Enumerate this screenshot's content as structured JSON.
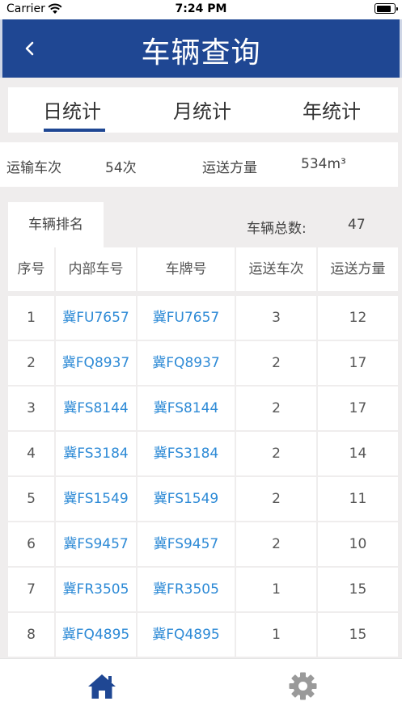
{
  "status_bar": {
    "carrier": "Carrier",
    "time": "7:24 PM"
  },
  "nav": {
    "title": "车辆查询"
  },
  "tabs": [
    {
      "label": "日统计",
      "selected": true
    },
    {
      "label": "月统计",
      "selected": false
    },
    {
      "label": "年统计",
      "selected": false
    }
  ],
  "summary": {
    "trips_label": "运输车次",
    "trips_value": "54次",
    "volume_label": "运送方量",
    "volume_value": "534m³"
  },
  "ranking": {
    "tab_label": "车辆排名",
    "total_label": "车辆总数:",
    "total_value": "47"
  },
  "table": {
    "headers": [
      "序号",
      "内部车号",
      "车牌号",
      "运送车次",
      "运送方量"
    ],
    "rows": [
      [
        "1",
        "冀FU7657",
        "冀FU7657",
        "3",
        "12"
      ],
      [
        "2",
        "冀FQ8937",
        "冀FQ8937",
        "2",
        "17"
      ],
      [
        "3",
        "冀FS8144",
        "冀FS8144",
        "2",
        "17"
      ],
      [
        "4",
        "冀FS3184",
        "冀FS3184",
        "2",
        "14"
      ],
      [
        "5",
        "冀FS1549",
        "冀FS1549",
        "2",
        "11"
      ],
      [
        "6",
        "冀FS9457",
        "冀FS9457",
        "2",
        "10"
      ],
      [
        "7",
        "冀FR3505",
        "冀FR3505",
        "1",
        "15"
      ],
      [
        "8",
        "冀FQ4895",
        "冀FQ4895",
        "1",
        "15"
      ]
    ]
  },
  "tabbar": {
    "items": [
      {
        "icon": "home-icon",
        "active": true
      },
      {
        "icon": "gear-icon",
        "active": false
      }
    ],
    "active_color": "#1f4793",
    "inactive_color": "#9a9a9a"
  },
  "colors": {
    "nav_bg": "#1f4793",
    "link": "#2d8ad6",
    "background": "#efeded"
  }
}
